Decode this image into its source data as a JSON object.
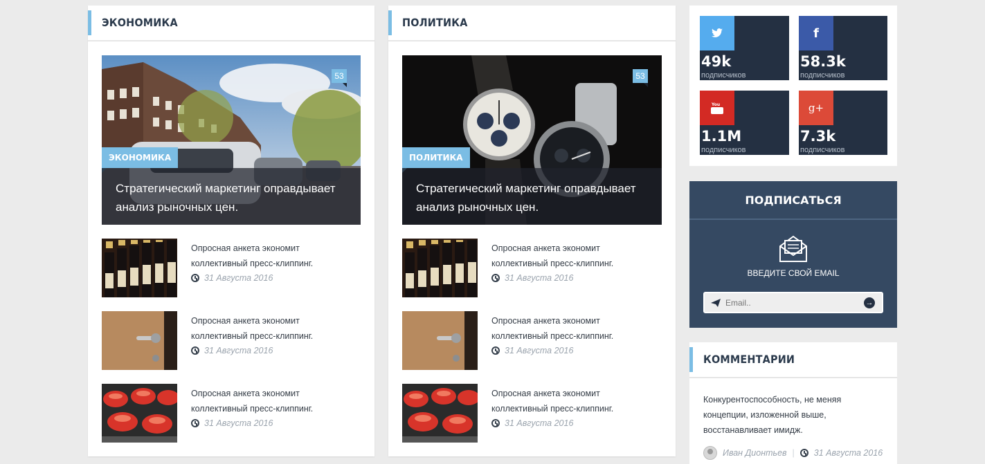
{
  "columns": [
    {
      "title": "ЭКОНОМИКА",
      "feature": {
        "count": "53",
        "category": "ЭКОНОМИКА",
        "headline": "Стратегический маркетинг оправдывает анализ рыночных цен."
      },
      "items": [
        {
          "text": "Опросная анкета экономит коллективный пресс-клиппинг.",
          "date": "31 Августа 2016"
        },
        {
          "text": "Опросная анкета экономит коллективный пресс-клиппинг.",
          "date": "31 Августа 2016"
        },
        {
          "text": "Опросная анкета экономит коллективный пресс-клиппинг.",
          "date": "31 Августа 2016"
        }
      ]
    },
    {
      "title": "ПОЛИТИКА",
      "feature": {
        "count": "53",
        "category": "ПОЛИТИКА",
        "headline": "Стратегический маркетинг оправдывает анализ рыночных цен."
      },
      "items": [
        {
          "text": "Опросная анкета экономит коллективный пресс-клиппинг.",
          "date": "31 Августа 2016"
        },
        {
          "text": "Опросная анкета экономит коллективный пресс-клиппинг.",
          "date": "31 Августа 2016"
        },
        {
          "text": "Опросная анкета экономит коллективный пресс-клиппинг.",
          "date": "31 Августа 2016"
        }
      ]
    }
  ],
  "social": [
    {
      "network": "twitter",
      "icon": "twitter-icon",
      "color": "#55acee",
      "count": "49k",
      "label": "подписчиков"
    },
    {
      "network": "facebook",
      "icon": "facebook-icon",
      "color": "#3b5aa8",
      "count": "58.3k",
      "label": "подписчиков"
    },
    {
      "network": "youtube",
      "icon": "youtube-icon",
      "color": "#d32a24",
      "count": "1.1M",
      "label": "подписчиков"
    },
    {
      "network": "google-plus",
      "icon": "google-plus-icon",
      "color": "#dc4a38",
      "count": "7.3k",
      "label": "подписчиков"
    }
  ],
  "subscribe": {
    "title": "ПОДПИСАТЬСЯ",
    "prompt": "ВВЕДИТЕ СВОЙ EMAIL",
    "placeholder": "Email.."
  },
  "comments": {
    "title": "КОММЕНТАРИИ",
    "text": "Конкурентоспособность, не меняя концепции, изложенной выше, восстанавливает имидж.",
    "author": "Иван Дионтьев",
    "date": "31 Августа 2016"
  },
  "colors": {
    "accent": "#7bbde4",
    "dark": "#243042",
    "subscribe_bg": "#354962"
  }
}
